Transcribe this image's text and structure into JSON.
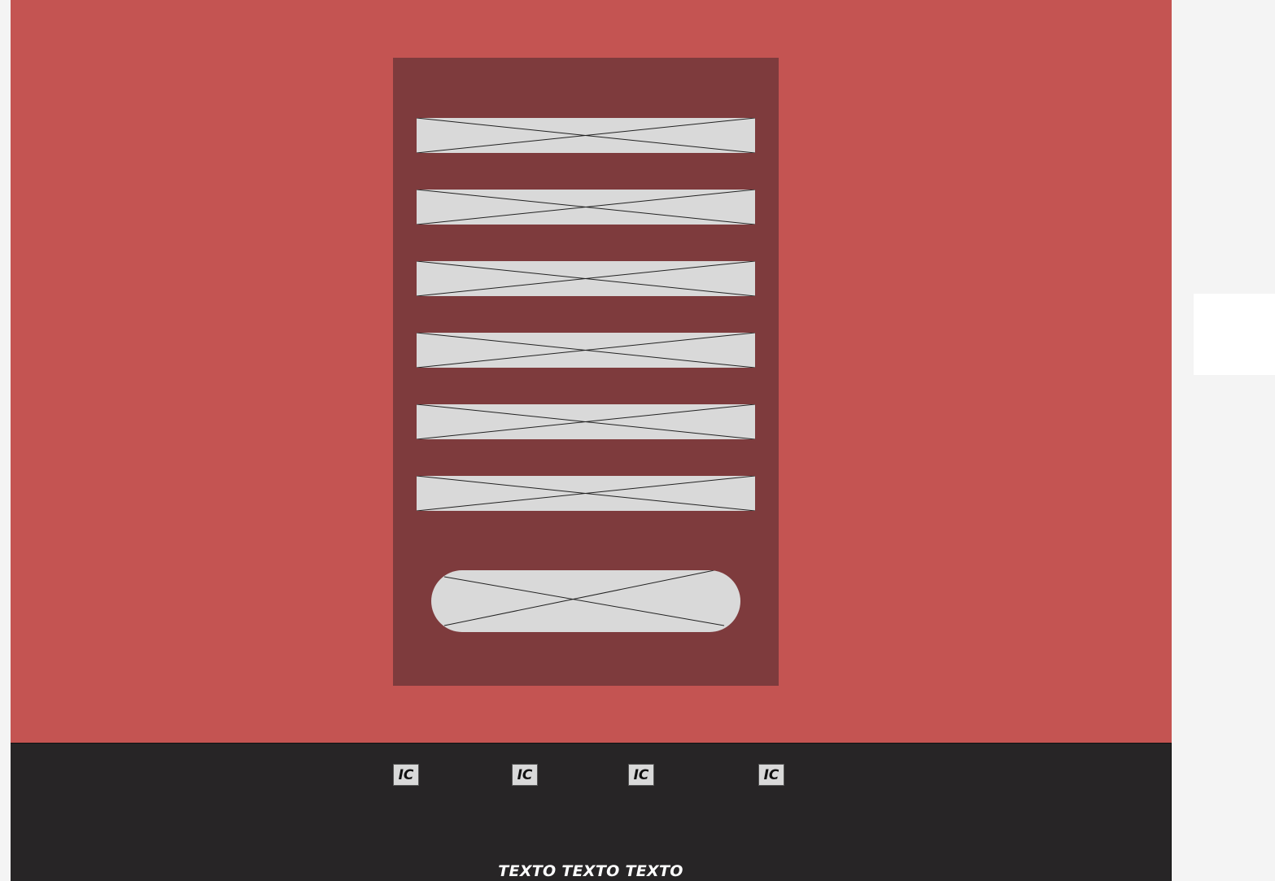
{
  "colors": {
    "canvas_background": "#c45452",
    "form_panel": "#7e3b3d",
    "placeholder": "#d9d9d9",
    "footer": "#272526",
    "footer_text": "#ffffff"
  },
  "form": {
    "fields": [
      {
        "icon": "image-placeholder-icon"
      },
      {
        "icon": "image-placeholder-icon"
      },
      {
        "icon": "image-placeholder-icon"
      },
      {
        "icon": "image-placeholder-icon"
      },
      {
        "icon": "image-placeholder-icon"
      },
      {
        "icon": "image-placeholder-icon"
      }
    ],
    "submit_button": {
      "icon": "image-placeholder-icon"
    }
  },
  "footer": {
    "icons": [
      {
        "label": "IC"
      },
      {
        "label": "IC"
      },
      {
        "label": "IC"
      },
      {
        "label": "IC"
      }
    ],
    "text": "TEXTO TEXTO TEXTO"
  }
}
